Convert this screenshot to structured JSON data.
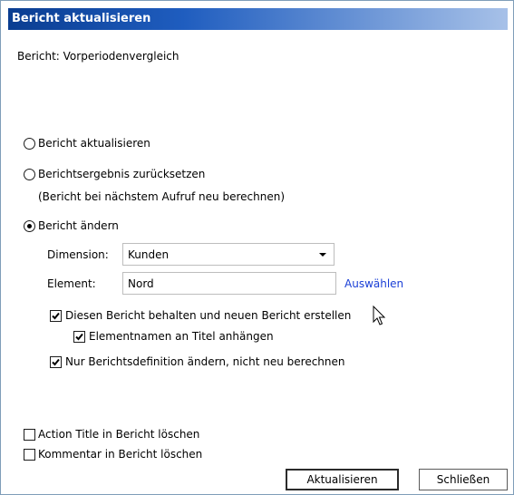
{
  "window": {
    "title": "Bericht aktualisieren"
  },
  "report_label": "Bericht: Vorperiodenvergleich",
  "options": {
    "refresh": {
      "label": "Bericht aktualisieren",
      "selected": false
    },
    "reset": {
      "label": "Berichtsergebnis zurücksetzen",
      "note": "(Bericht bei nächstem Aufruf neu berechnen)",
      "selected": false
    },
    "change": {
      "label": "Bericht ändern",
      "selected": true
    }
  },
  "dimension": {
    "label": "Dimension:",
    "value": "Kunden"
  },
  "element": {
    "label": "Element:",
    "value": "Nord",
    "select_link": "Auswählen"
  },
  "checkboxes": {
    "keep_report": {
      "label": "Diesen Bericht behalten und neuen Bericht erstellen",
      "checked": true
    },
    "append_names": {
      "label": "Elementnamen an Titel anhängen",
      "checked": true
    },
    "definition_only": {
      "label": "Nur Berichtsdefinition ändern, nicht neu berechnen",
      "checked": true
    },
    "delete_action_title": {
      "label": "Action Title in Bericht löschen",
      "checked": false
    },
    "delete_comment": {
      "label": "Kommentar in Bericht löschen",
      "checked": false
    }
  },
  "buttons": {
    "update": "Aktualisieren",
    "close": "Schließen"
  },
  "colors": {
    "title_start": "#0a3d91",
    "title_end": "#a7c1e8",
    "link": "#1a3fd6"
  }
}
